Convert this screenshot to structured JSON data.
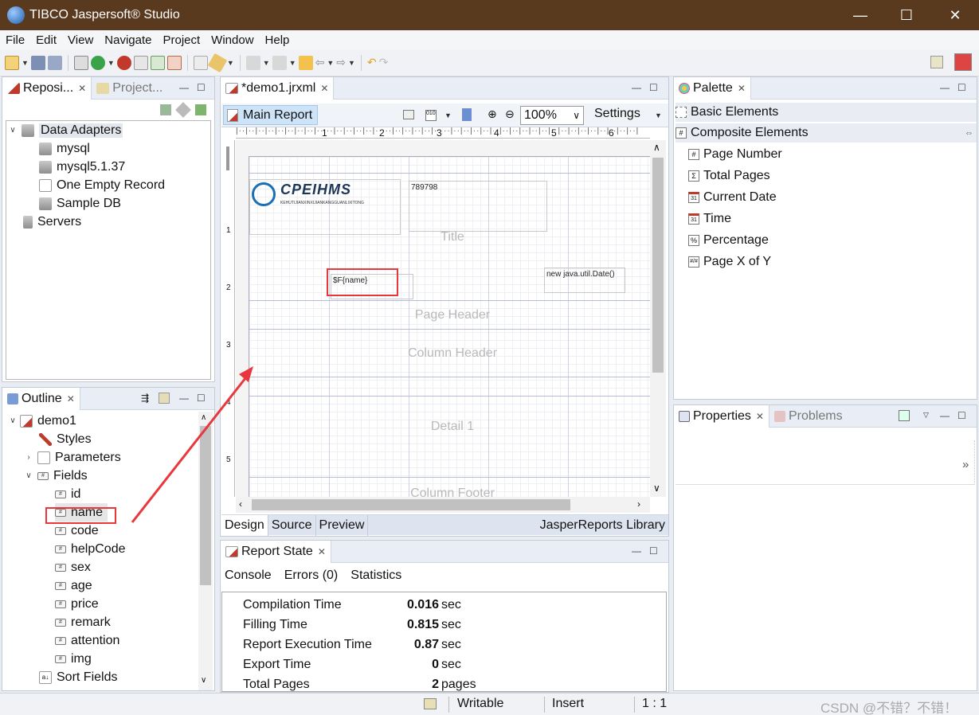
{
  "window": {
    "title": "TIBCO Jaspersoft® Studio",
    "min": "—",
    "max": "☐",
    "close": "✕"
  },
  "menu": [
    "File",
    "Edit",
    "View",
    "Navigate",
    "Project",
    "Window",
    "Help"
  ],
  "repo_panel": {
    "tabs": [
      "Reposi...",
      "Project..."
    ],
    "tree": [
      {
        "label": "Data Adapters",
        "level": 0,
        "expanded": true,
        "icon": "database-icon"
      },
      {
        "label": "mysql",
        "level": 1,
        "icon": "database-icon"
      },
      {
        "label": "mysql5.1.37",
        "level": 1,
        "icon": "database-icon"
      },
      {
        "label": "One Empty Record",
        "level": 1,
        "icon": "document-icon"
      },
      {
        "label": "Sample DB",
        "level": 1,
        "icon": "database-icon"
      },
      {
        "label": "Servers",
        "level": 0,
        "icon": "server-icon"
      }
    ]
  },
  "outline_panel": {
    "tab": "Outline",
    "tree": {
      "root": "demo1",
      "styles": "Styles",
      "parameters": "Parameters",
      "fields": "Fields",
      "field_items": [
        "id",
        "name",
        "code",
        "helpCode",
        "sex",
        "age",
        "price",
        "remark",
        "attention",
        "img"
      ],
      "sort_fields": "Sort Fields"
    }
  },
  "editor": {
    "tab": "*demo1.jrxml",
    "main_report": "Main Report",
    "zoom": "100%",
    "settings": "Settings",
    "ruler_labels": [
      "1",
      "2",
      "3",
      "4",
      "5",
      "6"
    ],
    "ruler_left_labels": [
      "1",
      "2",
      "3",
      "4",
      "5"
    ],
    "logo_title": "CPEIHMS",
    "logo_sub": "KEHUTIJIANXINXIJIANKANGGUANLIXITONG",
    "text_789": "789798",
    "field_expr": "$F{name}",
    "date_expr": "new java.util.Date()",
    "bands": {
      "title": "Title",
      "page_header": "Page Header",
      "column_header": "Column Header",
      "detail": "Detail 1",
      "column_footer": "Column Footer"
    },
    "bottom_tabs": [
      "Design",
      "Source",
      "Preview"
    ],
    "library": "JasperReports Library"
  },
  "report_state": {
    "tab": "Report State",
    "subtabs": [
      "Console",
      "Errors (0)",
      "Statistics"
    ],
    "rows": [
      {
        "label": "Compilation Time",
        "value": "0.016",
        "unit": "sec"
      },
      {
        "label": "Filling Time",
        "value": "0.815",
        "unit": "sec"
      },
      {
        "label": "Report Execution Time",
        "value": "0.87",
        "unit": "sec"
      },
      {
        "label": "Export Time",
        "value": "0",
        "unit": "sec"
      },
      {
        "label": "Total Pages",
        "value": "2",
        "unit": "pages"
      }
    ]
  },
  "palette": {
    "tab": "Palette",
    "basic": "Basic Elements",
    "composite": "Composite Elements",
    "items": [
      {
        "label": "Page Number",
        "icon": "#"
      },
      {
        "label": "Total Pages",
        "icon": "Σ"
      },
      {
        "label": "Current Date",
        "icon": "31"
      },
      {
        "label": "Time",
        "icon": "31"
      },
      {
        "label": "Percentage",
        "icon": "%"
      },
      {
        "label": "Page X of Y",
        "icon": "#/#"
      }
    ]
  },
  "properties": {
    "tabs": [
      "Properties",
      "Problems"
    ],
    "more": "»"
  },
  "statusbar": {
    "writable": "Writable",
    "insert": "Insert",
    "position": "1 : 1"
  },
  "watermark": "CSDN @不错？不错！",
  "colors": {
    "titlebar": "#5a3a1f",
    "annotation": "#e8383d",
    "selection": "#cde3f7"
  }
}
